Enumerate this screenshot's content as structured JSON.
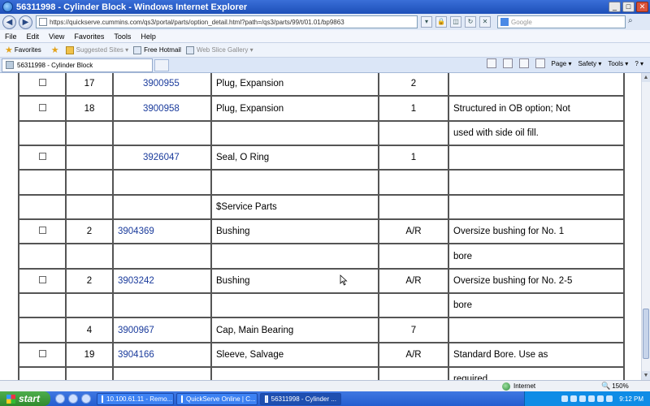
{
  "window": {
    "title": "56311998 - Cylinder Block - Windows Internet Explorer"
  },
  "address_bar": {
    "url": "https://quickserve.cummins.com/qs3/portal/parts/option_detail.html?path=/qs3/parts/99/t/01.01/bp9863",
    "search_placeholder": "Google"
  },
  "menu": {
    "items": [
      "File",
      "Edit",
      "View",
      "Favorites",
      "Tools",
      "Help"
    ]
  },
  "favorites_bar": {
    "favorites_label": "Favorites",
    "suggested_sites": "Suggested Sites ▾",
    "free_hotmail": "Free Hotmail",
    "web_slice_gallery": "Web Slice Gallery ▾"
  },
  "tabs": {
    "active_tab": "56311998 - Cylinder Block"
  },
  "command_bar": {
    "page": "Page ▾",
    "safety": "Safety ▾",
    "tools": "Tools ▾",
    "help": "? ▾"
  },
  "table": {
    "rows": [
      {
        "checkbox": true,
        "num": "17",
        "part": "3900955",
        "desc": "Plug, Expansion",
        "qty": "2",
        "remarks": ""
      },
      {
        "checkbox": true,
        "num": "18",
        "part": "3900958",
        "desc": "Plug, Expansion",
        "qty": "1",
        "remarks": "Structured in OB option; Not"
      },
      {
        "checkbox": false,
        "num": "",
        "part": "",
        "desc": "",
        "qty": "",
        "remarks": "used with side oil fill."
      },
      {
        "checkbox": true,
        "num": "",
        "part": "3926047",
        "desc": "Seal, O Ring",
        "qty": "1",
        "remarks": ""
      },
      {
        "checkbox": false,
        "num": "",
        "part": "",
        "desc": "",
        "qty": "",
        "remarks": ""
      },
      {
        "checkbox": false,
        "num": "",
        "part": "",
        "desc": "$Service Parts",
        "qty": "",
        "remarks": ""
      },
      {
        "checkbox": true,
        "num": "2",
        "part": "3904369",
        "desc": "Bushing",
        "qty": "A/R",
        "remarks": "Oversize bushing for No. 1"
      },
      {
        "checkbox": false,
        "num": "",
        "part": "",
        "desc": "",
        "qty": "",
        "remarks": "bore"
      },
      {
        "checkbox": true,
        "num": "2",
        "part": "3903242",
        "desc": "Bushing",
        "qty": "A/R",
        "remarks": "Oversize bushing for No. 2-5"
      },
      {
        "checkbox": false,
        "num": "",
        "part": "",
        "desc": "",
        "qty": "",
        "remarks": "bore"
      },
      {
        "checkbox": false,
        "num": "4",
        "part": "3900967",
        "desc": "Cap, Main Bearing",
        "qty": "7",
        "remarks": ""
      },
      {
        "checkbox": true,
        "num": "19",
        "part": "3904166",
        "desc": "Sleeve, Salvage",
        "qty": "A/R",
        "remarks": "Standard Bore. Use as"
      },
      {
        "checkbox": false,
        "num": "",
        "part": "",
        "desc": "",
        "qty": "",
        "remarks": "required."
      }
    ]
  },
  "status_bar": {
    "zone": "Internet",
    "zoom": "150%"
  },
  "taskbar": {
    "start": "start",
    "tasks": [
      "10.100.61.11 - Remo...",
      "QuickServe Online | C...",
      "56311998 - Cylinder ..."
    ],
    "clock": "9:12 PM"
  }
}
